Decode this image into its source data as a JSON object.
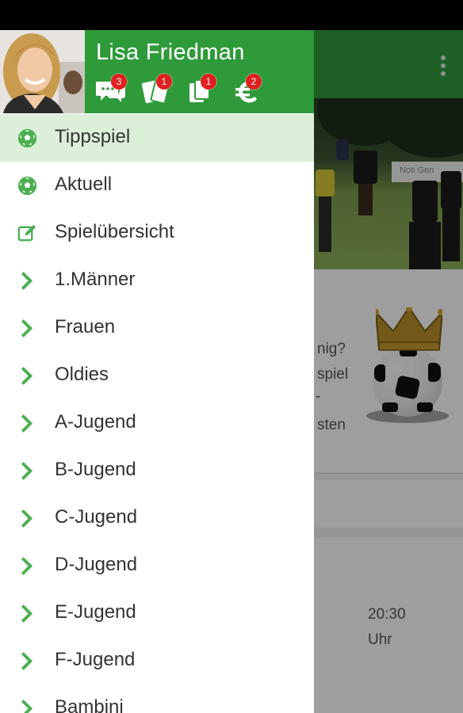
{
  "colors": {
    "accent": "#2f9a3a",
    "active_row": "#dcefd9",
    "badge": "#e02020",
    "chevron": "#4caf50"
  },
  "profile": {
    "name": "Lisa Friedman",
    "badges": [
      {
        "icon": "chat-bubbles-icon",
        "count": "3"
      },
      {
        "icon": "cards-icon",
        "count": "1"
      },
      {
        "icon": "documents-icon",
        "count": "1"
      },
      {
        "icon": "euro-icon",
        "count": "2"
      }
    ]
  },
  "menu": [
    {
      "label": "Tippspiel",
      "icon": "soccer-ball-icon",
      "active": true
    },
    {
      "label": "Aktuell",
      "icon": "soccer-ball-icon"
    },
    {
      "label": "Spielübersicht",
      "icon": "edit-icon"
    },
    {
      "label": "1.Männer",
      "icon": "chevron-right-icon"
    },
    {
      "label": "Frauen",
      "icon": "chevron-right-icon"
    },
    {
      "label": "Oldies",
      "icon": "chevron-right-icon"
    },
    {
      "label": "A-Jugend",
      "icon": "chevron-right-icon"
    },
    {
      "label": "B-Jugend",
      "icon": "chevron-right-icon"
    },
    {
      "label": "C-Jugend",
      "icon": "chevron-right-icon"
    },
    {
      "label": "D-Jugend",
      "icon": "chevron-right-icon"
    },
    {
      "label": "E-Jugend",
      "icon": "chevron-right-icon"
    },
    {
      "label": "F-Jugend",
      "icon": "chevron-right-icon"
    },
    {
      "label": "Bambini",
      "icon": "chevron-right-icon"
    }
  ],
  "background": {
    "photo_sign": "Noti Gen",
    "card_lines": [
      "nig?",
      "spiel",
      "-",
      "sten"
    ],
    "match_time": "20:30",
    "match_time_unit": "Uhr"
  }
}
